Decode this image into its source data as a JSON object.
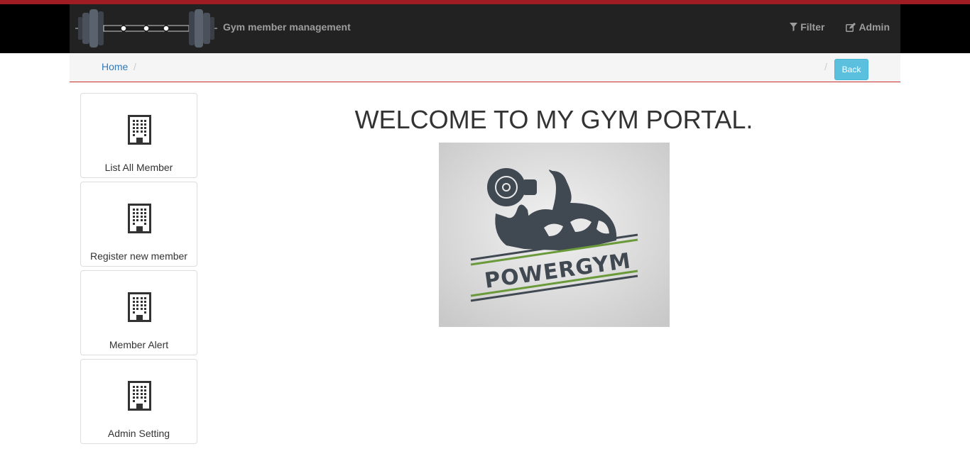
{
  "header": {
    "brand_title": "Gym member management",
    "brand_logo_icon": "barbell-icon",
    "nav": [
      {
        "label": "Filter",
        "icon": "filter-icon"
      },
      {
        "label": "Admin",
        "icon": "edit-icon"
      }
    ]
  },
  "breadcrumb": {
    "home": "Home",
    "separator": "/",
    "back_label": "Back"
  },
  "sidebar": {
    "tiles": [
      {
        "label": "List All Member",
        "icon": "building-icon"
      },
      {
        "label": "Register new member",
        "icon": "building-icon"
      },
      {
        "label": "Member Alert",
        "icon": "building-icon"
      },
      {
        "label": "Admin Setting",
        "icon": "building-icon"
      }
    ]
  },
  "main": {
    "welcome": "WELCOME TO MY GYM PORTAL.",
    "logo_text": "POWERGYM"
  },
  "colors": {
    "top_stripe": "#9e1c22",
    "navbar": "#222222",
    "back_button": "#5bc0de",
    "link": "#337ab7",
    "logo_green": "#6a9a3a",
    "logo_dark": "#404852"
  }
}
